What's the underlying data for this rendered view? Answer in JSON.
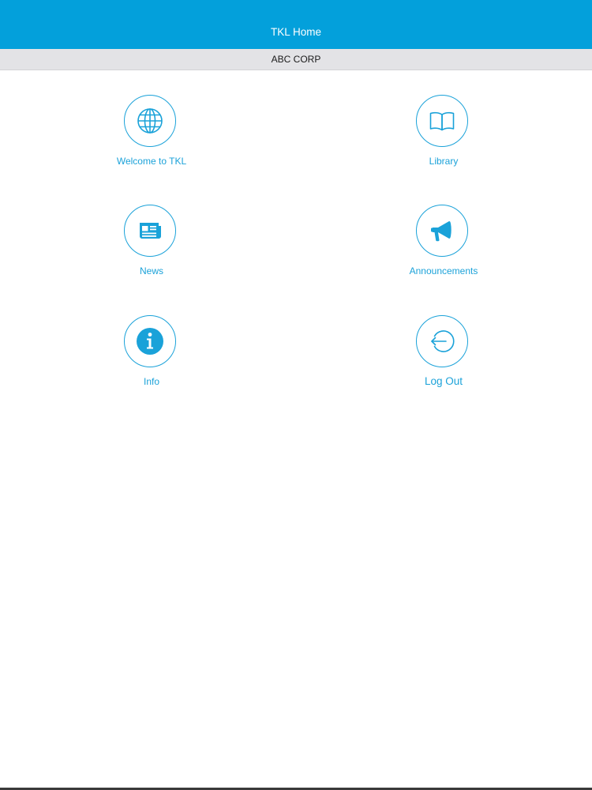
{
  "navbar": {
    "title": "TKL Home",
    "color": "#03a0db"
  },
  "subheader": {
    "label": "ABC CORP"
  },
  "accent_color": "#1aa2d9",
  "tiles": [
    {
      "label": "Welcome to TKL",
      "icon": "globe-icon"
    },
    {
      "label": "Library",
      "icon": "book-icon"
    },
    {
      "label": "News",
      "icon": "newspaper-icon"
    },
    {
      "label": "Announcements",
      "icon": "megaphone-icon"
    },
    {
      "label": "Info",
      "icon": "info-icon"
    },
    {
      "label": "Log Out",
      "icon": "logout-icon"
    }
  ]
}
